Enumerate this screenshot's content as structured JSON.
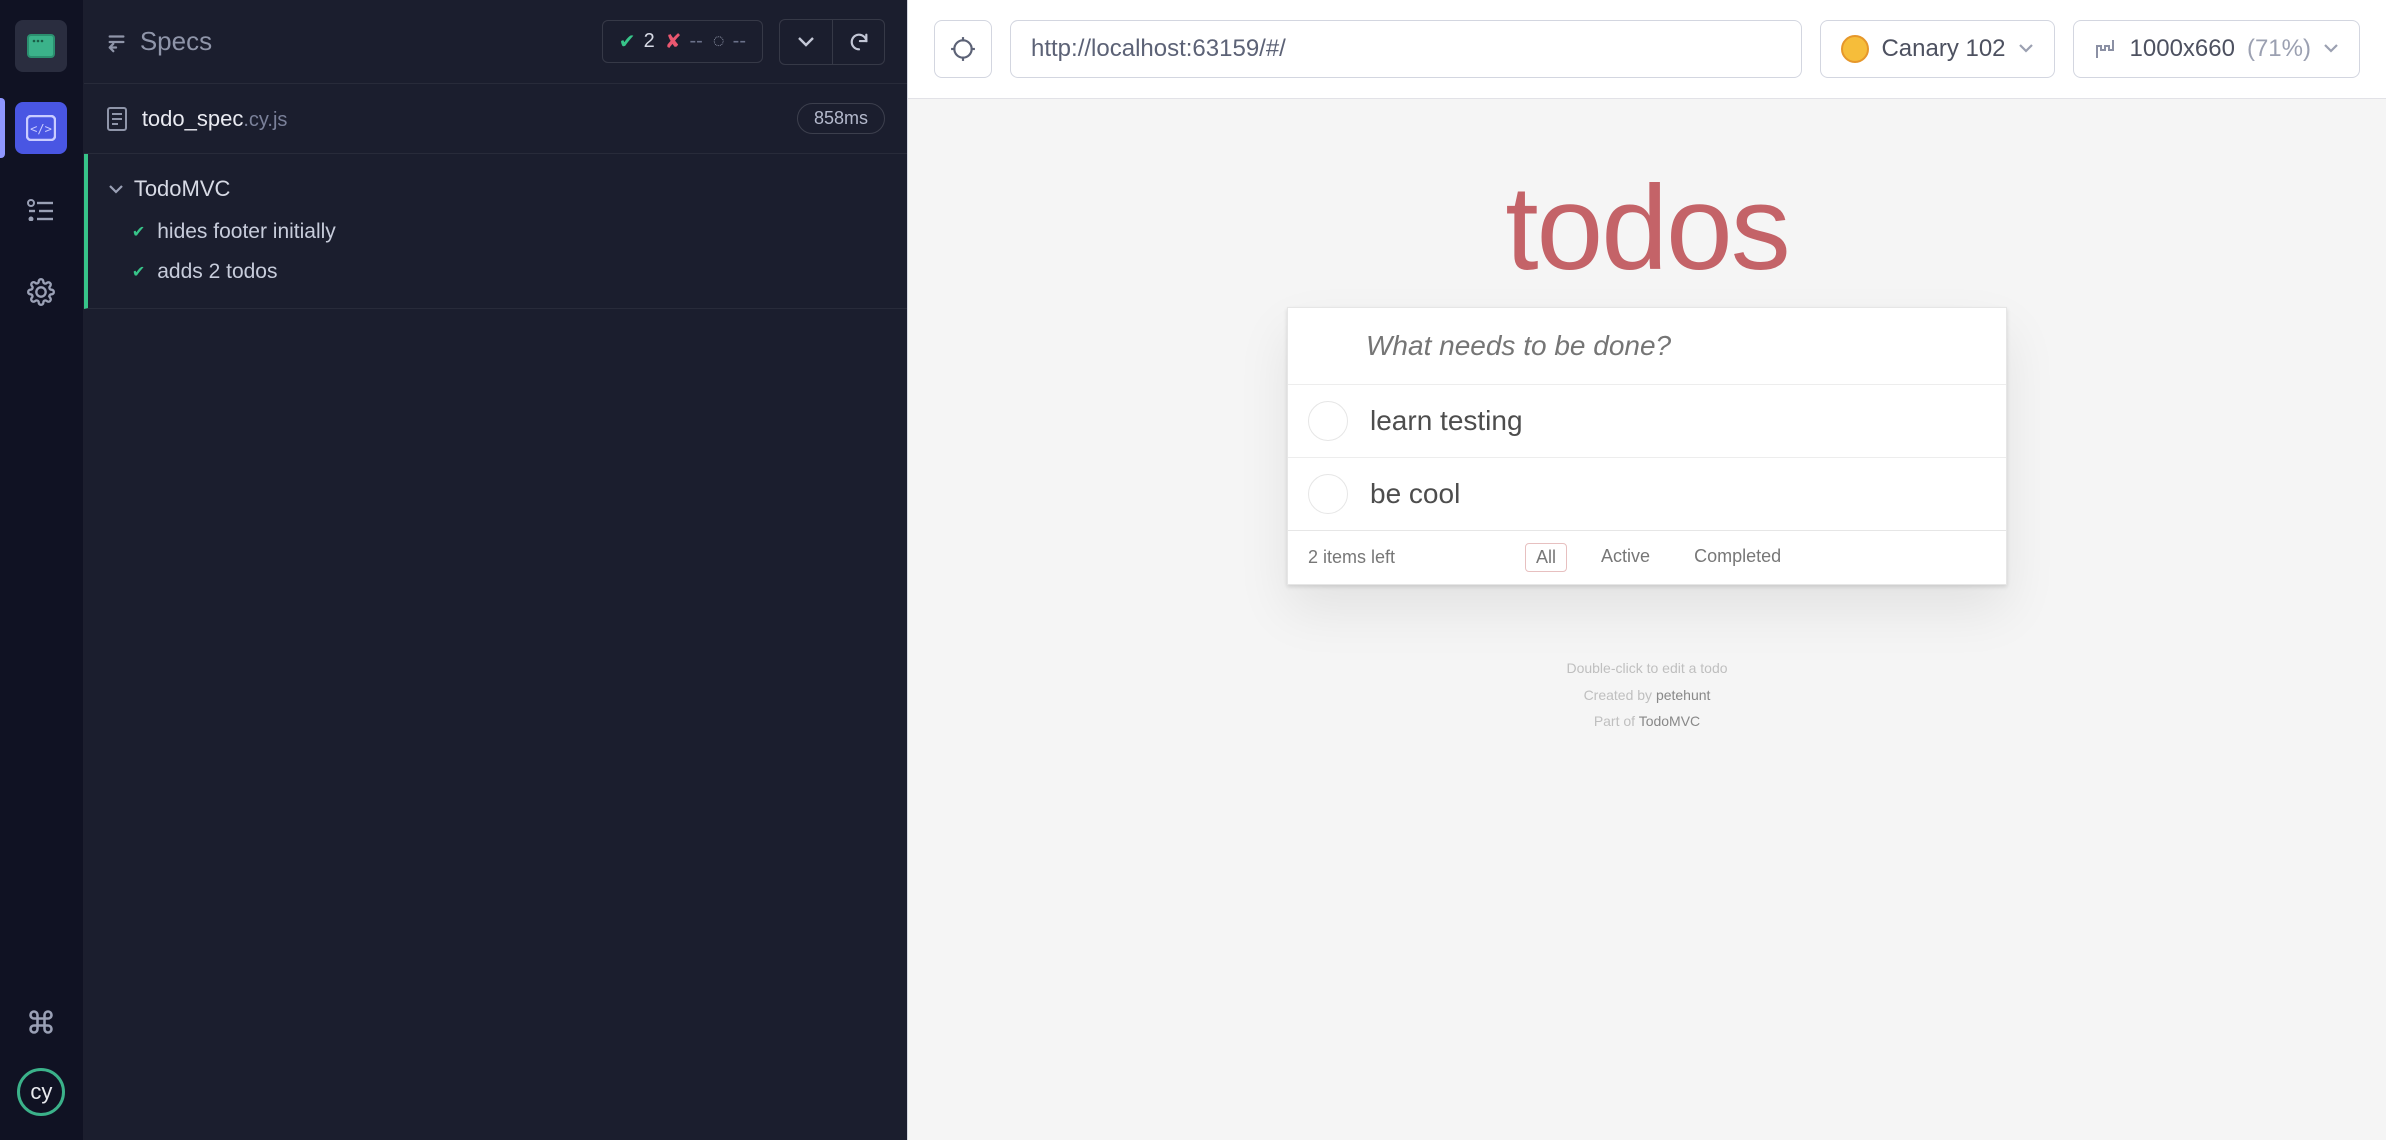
{
  "reporter": {
    "back_label": "Specs",
    "stats": {
      "passed": "2",
      "failed": "--",
      "pending": "--"
    },
    "spec": {
      "name": "todo_spec",
      "ext": ".cy.js",
      "duration": "858ms"
    },
    "suite": {
      "title": "TodoMVC",
      "tests": [
        "hides footer initially",
        "adds 2 todos"
      ]
    }
  },
  "aut": {
    "url": "http://localhost:63159/#/",
    "browser": "Canary 102",
    "viewport": "1000x660",
    "scale": "(71%)"
  },
  "todomvc": {
    "title": "todos",
    "placeholder": "What needs to be done?",
    "items": [
      "learn testing",
      "be cool"
    ],
    "items_left": "2 items left",
    "filters": {
      "all": "All",
      "active": "Active",
      "completed": "Completed"
    },
    "info": {
      "line1": "Double-click to edit a todo",
      "created_prefix": "Created by ",
      "created_by": "petehunt",
      "partof_prefix": "Part of ",
      "partof": "TodoMVC"
    }
  },
  "rail": {
    "logo_text": "cy"
  }
}
